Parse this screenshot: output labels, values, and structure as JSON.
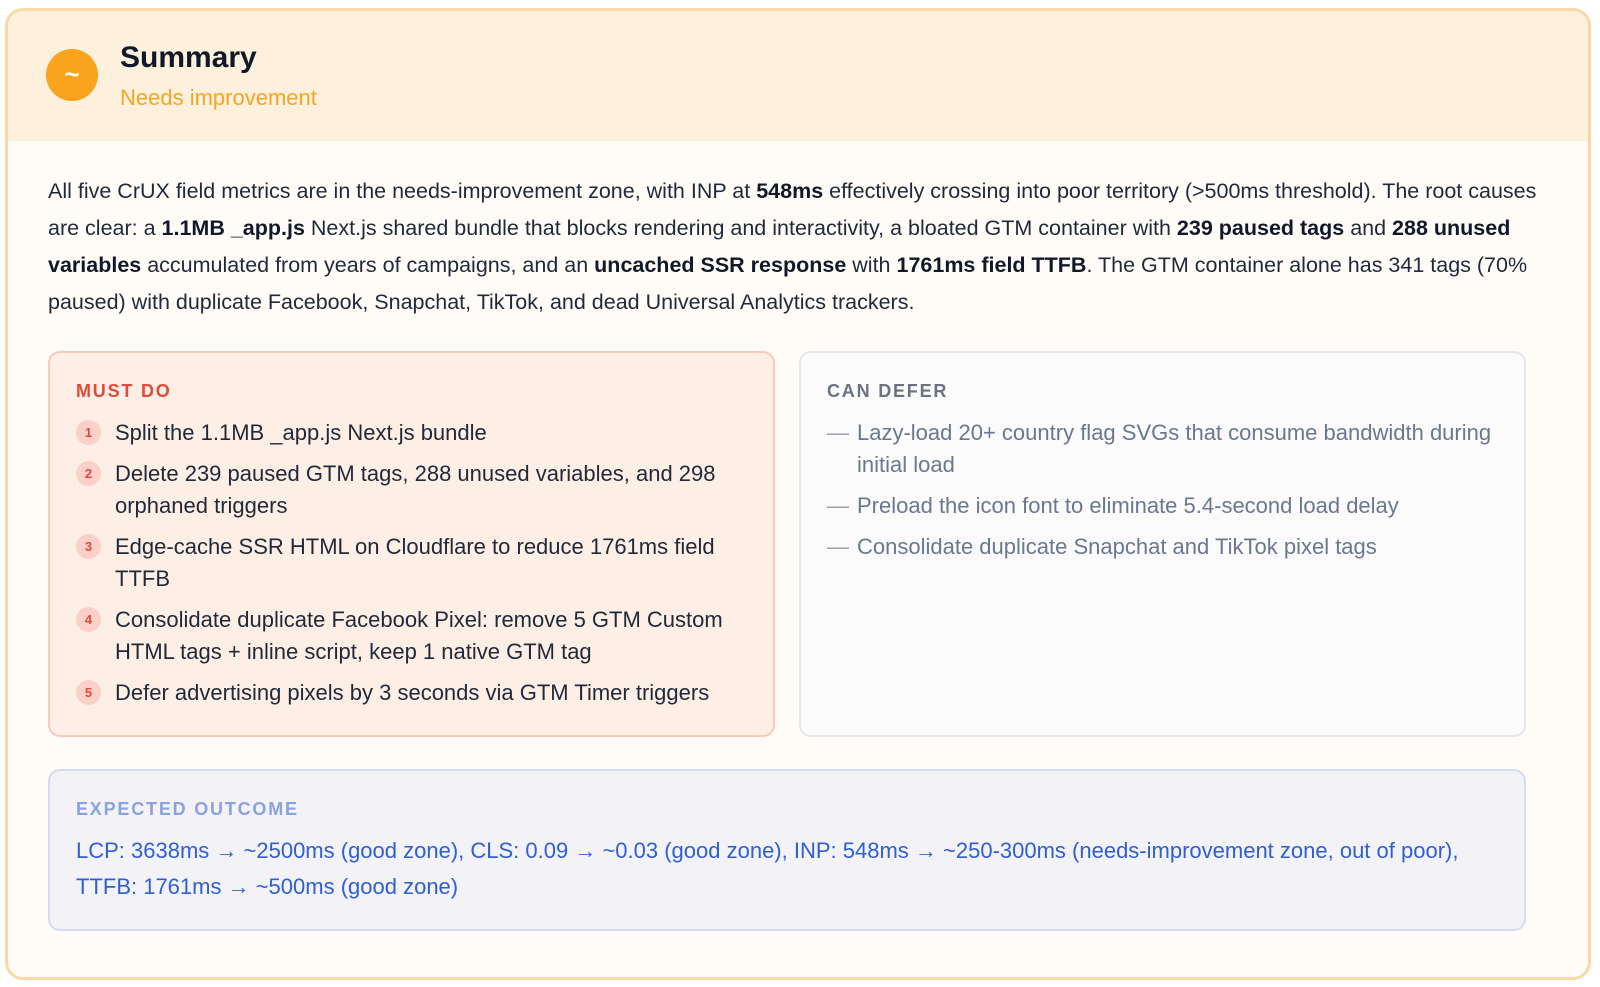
{
  "header": {
    "icon_glyph": "~",
    "icon_name": "status-tilde-icon",
    "title": "Summary",
    "status": "Needs improvement",
    "status_color": "#f5a524"
  },
  "summary": {
    "parts": [
      {
        "text": "All five CrUX field metrics are in the needs-improvement zone, with INP at ",
        "bold": false
      },
      {
        "text": "548ms",
        "bold": true
      },
      {
        "text": " effectively crossing into poor territory (>500ms threshold). The root causes are clear: a ",
        "bold": false
      },
      {
        "text": "1.1MB _app.js",
        "bold": true
      },
      {
        "text": " Next.js shared bundle that blocks rendering and interactivity, a bloated GTM container with ",
        "bold": false
      },
      {
        "text": "239 paused tags",
        "bold": true
      },
      {
        "text": " and ",
        "bold": false
      },
      {
        "text": "288 unused variables",
        "bold": true
      },
      {
        "text": " accumulated from years of campaigns, and an ",
        "bold": false
      },
      {
        "text": "uncached SSR response",
        "bold": true
      },
      {
        "text": " with ",
        "bold": false
      },
      {
        "text": "1761ms field TTFB",
        "bold": true
      },
      {
        "text": ". The GTM container alone has 341 tags (70% paused) with duplicate Facebook, Snapchat, TikTok, and dead Universal Analytics trackers.",
        "bold": false
      }
    ]
  },
  "must_do": {
    "title": "MUST DO",
    "items": [
      {
        "num": "1",
        "text": "Split the 1.1MB _app.js Next.js bundle"
      },
      {
        "num": "2",
        "text": "Delete 239 paused GTM tags, 288 unused variables, and 298 orphaned triggers"
      },
      {
        "num": "3",
        "text": "Edge-cache SSR HTML on Cloudflare to reduce 1761ms field TTFB"
      },
      {
        "num": "4",
        "text": "Consolidate duplicate Facebook Pixel: remove 5 GTM Custom HTML tags + inline script, keep 1 native GTM tag"
      },
      {
        "num": "5",
        "text": "Defer advertising pixels by 3 seconds via GTM Timer triggers"
      }
    ]
  },
  "can_defer": {
    "title": "CAN DEFER",
    "bullet": "—",
    "items": [
      {
        "text": "Lazy-load 20+ country flag SVGs that consume bandwidth during initial load"
      },
      {
        "text": "Preload the icon font to eliminate 5.4-second load delay"
      },
      {
        "text": "Consolidate duplicate Snapchat and TikTok pixel tags"
      }
    ]
  },
  "outcome": {
    "title": "EXPECTED OUTCOME",
    "text": "LCP: 3638ms → ~2500ms (good zone), CLS: 0.09 → ~0.03 (good zone), INP: 548ms → ~250-300ms (needs-improvement zone, out of poor), TTFB: 1761ms → ~500ms (good zone)"
  }
}
